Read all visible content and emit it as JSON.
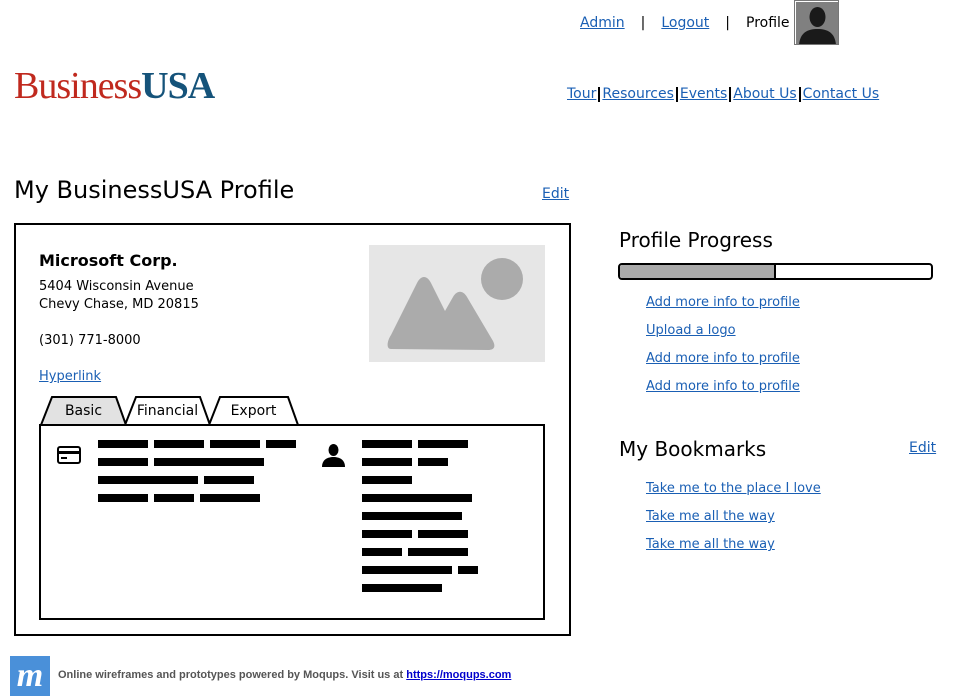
{
  "header": {
    "user_links": [
      "Admin",
      "Logout"
    ],
    "profile_label": "Profile",
    "logo": {
      "part1": "Business",
      "part2": "USA",
      "color1": "#c0291e",
      "color2": "#15537a"
    },
    "nav": [
      "Tour",
      "Resources",
      "Events",
      "About Us",
      "Contact Us"
    ]
  },
  "main": {
    "title": "My BusinessUSA Profile",
    "edit_label": "Edit",
    "company": {
      "name": "Microsoft Corp.",
      "address_line1": "5404 Wisconsin Avenue",
      "address_line2": "Chevy Chase, MD 20815",
      "phone": "(301) 771-8000",
      "hyperlink": "Hyperlink"
    },
    "tabs": [
      {
        "label": "Basic",
        "active": true
      },
      {
        "label": "Financial",
        "active": false
      },
      {
        "label": "Export",
        "active": false
      }
    ]
  },
  "sidebar": {
    "progress_title": "Profile Progress",
    "progress_fraction": 0.5,
    "progress_links": [
      "Add more info to profile",
      "Upload a logo",
      "Add more info to profile",
      "Add more info to profile"
    ],
    "bookmarks_title": "My Bookmarks",
    "bookmarks_edit": "Edit",
    "bookmarks": [
      "Take me to the place I love",
      "Take me all the way",
      "Take me all the way"
    ]
  },
  "footer": {
    "logo_letter": "m",
    "text": "Online wireframes and prototypes powered by Moqups. Visit us at",
    "link": "https://moqups.com"
  },
  "icons": {
    "avatar": "user-silhouette-icon",
    "image_placeholder": "image-placeholder-icon",
    "card": "credit-card-icon",
    "person": "person-icon"
  }
}
